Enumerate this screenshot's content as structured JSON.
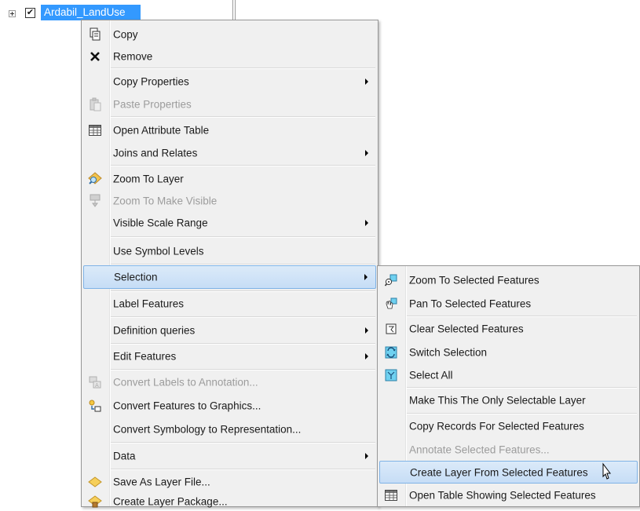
{
  "toc": {
    "layer_name": "Ardabil_LandUse",
    "checked_glyph": "✔"
  },
  "context_menu": {
    "items": [
      {
        "label": "Copy",
        "icon": "copy-icon"
      },
      {
        "label": "Remove",
        "icon": "remove-x-icon"
      },
      {
        "label": "Copy Properties",
        "submenu": true
      },
      {
        "label": "Paste Properties",
        "icon": "paste-icon",
        "disabled": true
      },
      {
        "label": "Open Attribute Table",
        "icon": "table-icon"
      },
      {
        "label": "Joins and Relates",
        "submenu": true
      },
      {
        "label": "Zoom To Layer",
        "icon": "zoom-to-layer-icon"
      },
      {
        "label": "Zoom To Make Visible",
        "icon": "zoom-visible-icon",
        "disabled": true
      },
      {
        "label": "Visible Scale Range",
        "submenu": true
      },
      {
        "label": "Use Symbol Levels"
      },
      {
        "label": "Selection",
        "submenu": true,
        "highlighted": true
      },
      {
        "label": "Label Features"
      },
      {
        "label": "Definition queries",
        "submenu": true
      },
      {
        "label": "Edit Features",
        "submenu": true
      },
      {
        "label": "Convert Labels to Annotation...",
        "icon": "convert-labels-icon",
        "disabled": true
      },
      {
        "label": "Convert Features to Graphics...",
        "icon": "convert-graphics-icon"
      },
      {
        "label": "Convert Symbology to Representation..."
      },
      {
        "label": "Data",
        "submenu": true
      },
      {
        "label": "Save As Layer File...",
        "icon": "layer-file-icon"
      },
      {
        "label": "Create Layer Package...",
        "icon": "layer-package-icon"
      }
    ]
  },
  "selection_submenu": {
    "items": [
      {
        "label": "Zoom To Selected Features",
        "icon": "zoom-selected-icon"
      },
      {
        "label": "Pan To Selected Features",
        "icon": "pan-selected-icon"
      },
      {
        "label": "Clear Selected Features",
        "icon": "clear-selection-icon"
      },
      {
        "label": "Switch Selection",
        "icon": "switch-selection-icon"
      },
      {
        "label": "Select All",
        "icon": "select-all-icon"
      },
      {
        "label": "Make This The Only Selectable Layer"
      },
      {
        "label": "Copy Records For Selected Features"
      },
      {
        "label": "Annotate Selected Features...",
        "disabled": true
      },
      {
        "label": "Create Layer From Selected Features",
        "highlighted": true
      },
      {
        "label": "Open Table Showing Selected Features",
        "icon": "table-icon"
      }
    ]
  },
  "colors": {
    "selection_blue": "#3399ff",
    "menu_background": "#f0f0f0",
    "hover_border": "#7fb3e6",
    "disabled_text": "#9c9c9c"
  }
}
